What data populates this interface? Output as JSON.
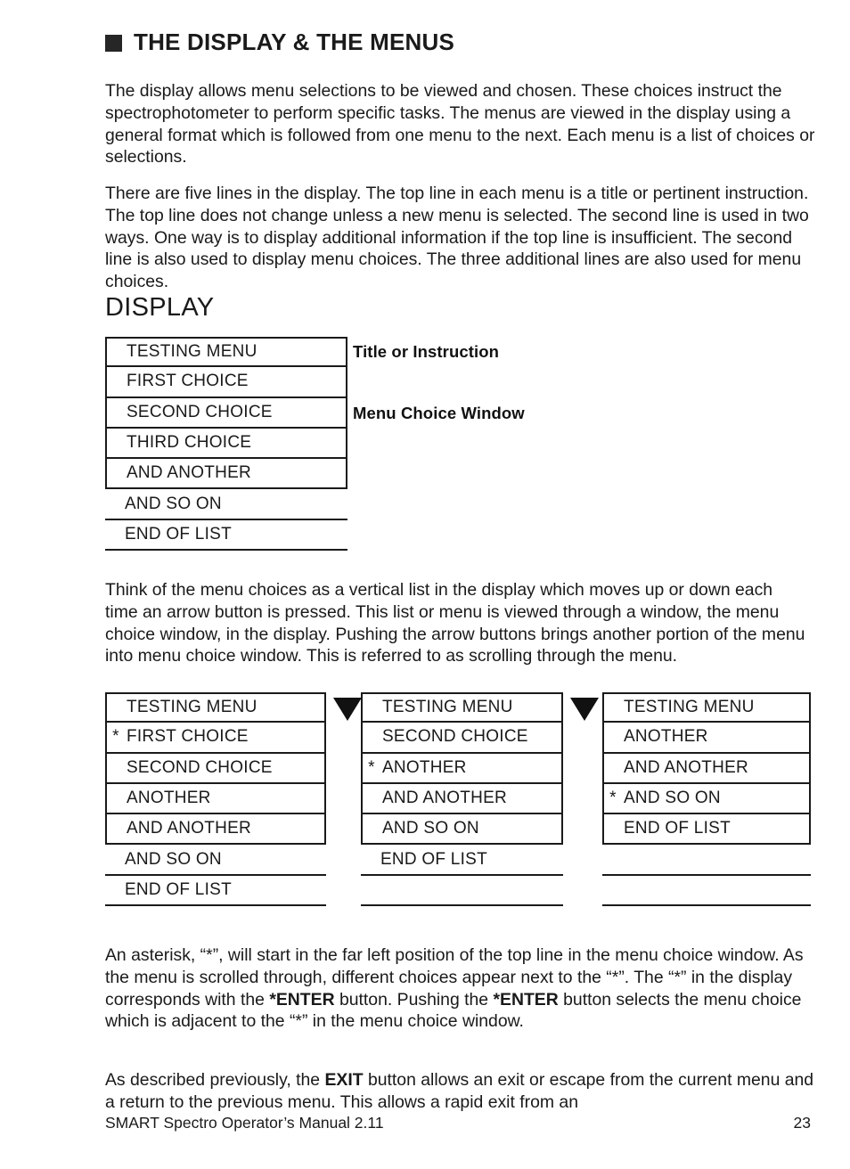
{
  "header": {
    "bullet": "black-square-bullet",
    "title": "THE DISPLAY & THE MENUS"
  },
  "paragraphs": {
    "intro": "The display allows menu selections to be viewed and chosen. These choices instruct the spectrophotometer to perform specific tasks. The menus are viewed in the display using a general format which is followed from one menu to the next. Each menu is a list of choices or selections.",
    "lines": "There are five lines in the display. The top line in each menu is a title or pertinent instruction. The top line does not change unless a new menu is selected. The second line is used in two ways. One way is to display additional information if the top line is insufficient. The second line is also used to display menu choices. The three additional lines are also used for menu choices.",
    "scrolling": "Think of the menu choices as a vertical list in the display which moves up or down each time an arrow button is pressed. This list or menu is viewed through a window, the menu choice window, in the display. Pushing the arrow buttons brings another portion of the menu into menu choice window. This is referred to as scrolling through the menu.",
    "asterisk_part1": "An asterisk, “*”, will start in the far left position of the top line in the menu choice window. As the menu is scrolled through, different choices appear next to the “*”. The “*” in the display corresponds with the ",
    "asterisk_bold1": "*ENTER",
    "asterisk_part2": " button. Pushing the ",
    "asterisk_bold2": "*ENTER",
    "asterisk_part3": " button selects the menu choice which is adjacent to the “*” in the menu choice window.",
    "exit_part1": "As described previously, the ",
    "exit_bold": "EXIT",
    "exit_part2": " button allows an exit or escape from the current menu and a return to the previous menu. This allows a rapid exit from an"
  },
  "display_section": {
    "heading": "DISPLAY",
    "labels": {
      "title_or_instruction": "Title or Instruction",
      "menu_choice_window": "Menu Choice Window"
    },
    "panel": {
      "framed_rows": [
        "TESTING MENU",
        "FIRST CHOICE",
        "SECOND CHOICE",
        "THIRD CHOICE",
        "AND ANOTHER"
      ],
      "open_rows": [
        "AND SO ON",
        "END OF LIST"
      ]
    }
  },
  "scroll_panels": [
    {
      "name": "panel-a",
      "framed_rows": [
        {
          "star": "",
          "text": "TESTING MENU"
        },
        {
          "star": "*",
          "text": "FIRST CHOICE"
        },
        {
          "star": "",
          "text": "SECOND CHOICE"
        },
        {
          "star": "",
          "text": "ANOTHER"
        },
        {
          "star": "",
          "text": "AND ANOTHER"
        }
      ],
      "open_rows": [
        {
          "star": "",
          "text": "AND SO ON"
        },
        {
          "star": "",
          "text": "END OF LIST"
        }
      ]
    },
    {
      "name": "panel-b",
      "framed_rows": [
        {
          "star": "",
          "text": "TESTING MENU"
        },
        {
          "star": "",
          "text": "SECOND CHOICE"
        },
        {
          "star": "*",
          "text": "ANOTHER"
        },
        {
          "star": "",
          "text": "AND ANOTHER"
        },
        {
          "star": "",
          "text": "AND SO ON"
        }
      ],
      "open_rows": [
        {
          "star": "",
          "text": "END OF LIST"
        },
        {
          "star": "",
          "text": ""
        }
      ]
    },
    {
      "name": "panel-c",
      "framed_rows": [
        {
          "star": "",
          "text": "TESTING MENU"
        },
        {
          "star": "",
          "text": "ANOTHER"
        },
        {
          "star": "",
          "text": "AND ANOTHER"
        },
        {
          "star": "*",
          "text": "AND SO ON"
        },
        {
          "star": "",
          "text": "END OF LIST"
        }
      ],
      "open_rows": [
        {
          "star": "",
          "text": ""
        },
        {
          "star": "",
          "text": ""
        }
      ]
    }
  ],
  "arrows": [
    {
      "name": "scroll-arrow-1",
      "icon": "triangle-down-icon"
    },
    {
      "name": "scroll-arrow-2",
      "icon": "triangle-down-icon"
    }
  ],
  "footer": {
    "manual": "SMART Spectro Operator’s Manual  2.11",
    "page_number": "23"
  }
}
